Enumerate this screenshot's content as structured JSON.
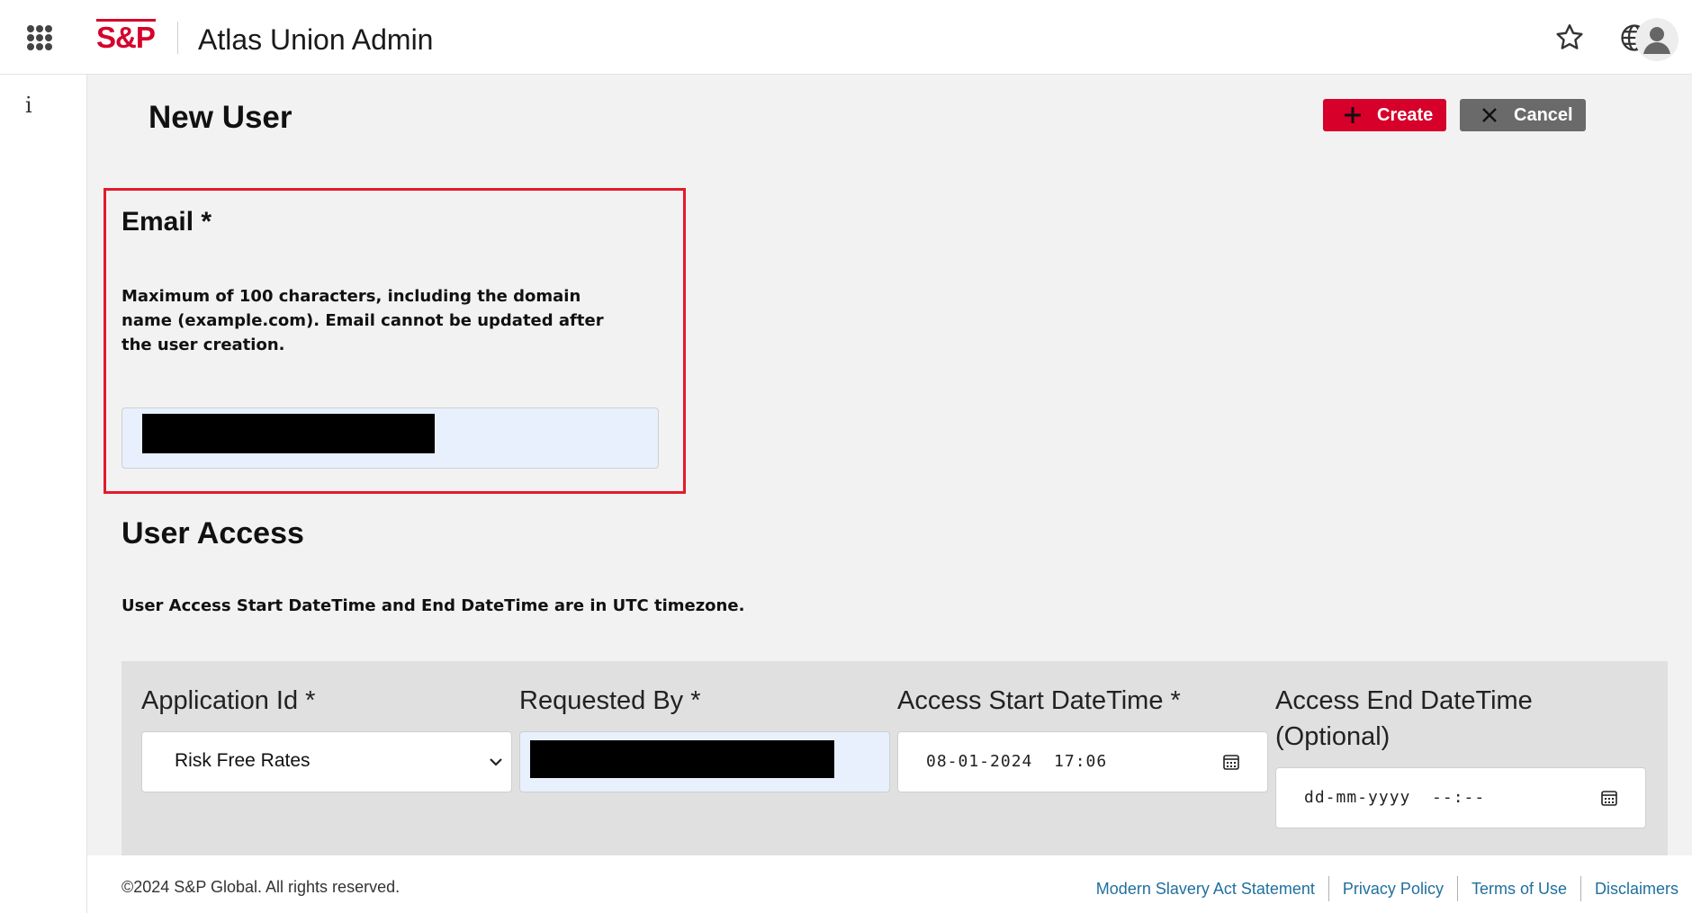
{
  "header": {
    "logo_text": "S&P",
    "app_title": "Atlas Union Admin",
    "icons": [
      "apps-grid-icon",
      "star-icon",
      "globe-icon",
      "user-avatar-icon"
    ]
  },
  "rail": {
    "info_glyph": "i"
  },
  "page": {
    "title": "New User",
    "create_label": "Create",
    "cancel_label": "Cancel"
  },
  "email": {
    "label": "Email *",
    "help": "Maximum of 100 characters, including the domain name (example.com). Email cannot be updated after the user creation."
  },
  "access": {
    "title": "User Access",
    "note": "User Access Start DateTime and End DateTime are in UTC timezone.",
    "fields": {
      "application_label": "Application Id *",
      "application_value": "Risk Free Rates",
      "requested_by_label": "Requested By *",
      "start_label": "Access Start DateTime *",
      "start_value": "08-01-2024  17:06",
      "end_label": "Access End DateTime (Optional)",
      "end_placeholder": "dd-mm-yyyy  --:--"
    }
  },
  "footer": {
    "copyright": "©2024 S&P Global. All rights reserved.",
    "links": [
      "Modern Slavery Act Statement",
      "Privacy Policy",
      "Terms of Use",
      "Disclaimers"
    ]
  },
  "colors": {
    "brand_red": "#d6002a",
    "highlight_border": "#e21b2b",
    "cancel_gray": "#6a6a6a",
    "link_blue": "#1f6f9f",
    "autofill_blue": "#e8f0fe"
  }
}
